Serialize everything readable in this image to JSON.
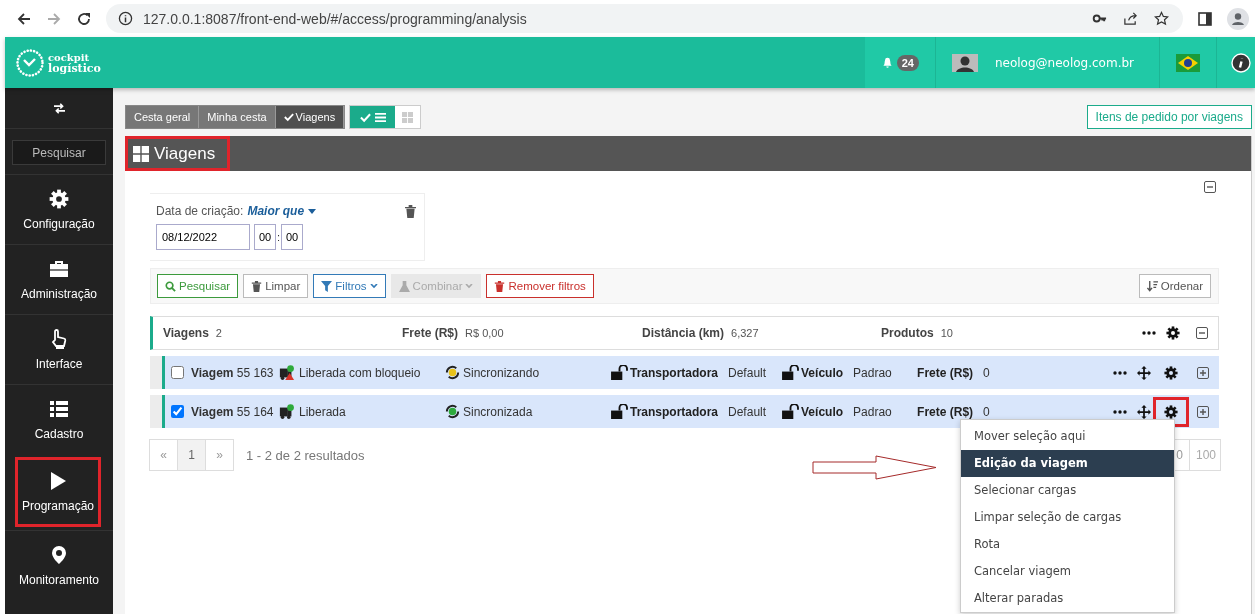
{
  "browser": {
    "url": "127.0.0.1:8087/front-end-web/#/access/programming/analysis",
    "forward_disabled": true
  },
  "header": {
    "logo": [
      "cockpit",
      "logístico"
    ],
    "notifications": "24",
    "user": "neolog@neolog.com.br"
  },
  "sidebar": {
    "search": {
      "placeholder": "Pesquisar"
    },
    "items": [
      {
        "label": "Configuração",
        "kind": "gear",
        "highlighted": false
      },
      {
        "label": "Administração",
        "kind": "briefcase",
        "highlighted": false
      },
      {
        "label": "Interface",
        "kind": "hand",
        "highlighted": false
      },
      {
        "label": "Cadastro",
        "kind": "list",
        "highlighted": false
      },
      {
        "label": "Programação",
        "kind": "play",
        "highlighted": true
      },
      {
        "label": "Monitoramento",
        "kind": "pin",
        "highlighted": false
      }
    ]
  },
  "tabs": [
    {
      "label": "Cesta geral",
      "selected": false
    },
    {
      "label": "Minha cesta",
      "selected": false
    },
    {
      "label": "Viagens",
      "selected": true
    }
  ],
  "views": [
    {
      "kind": "list",
      "selected": true
    },
    {
      "kind": "grid",
      "selected": false
    }
  ],
  "side_button": "Itens de pedido por viagens",
  "panel": {
    "title": "Viagens",
    "highlighted": true
  },
  "filter": {
    "label": "Data de criação:",
    "operator": "Maior que",
    "date": "08/12/2022",
    "hour": "00",
    "separator": ":",
    "minute": "00"
  },
  "toolbar": [
    {
      "label": "Pesquisar",
      "kind": "search",
      "caret": false,
      "disabled": false
    },
    {
      "label": "Limpar",
      "kind": "clear",
      "caret": false,
      "disabled": false
    },
    {
      "label": "Filtros",
      "kind": "filter",
      "caret": true,
      "disabled": false
    },
    {
      "label": "Combinar",
      "kind": "combine",
      "caret": true,
      "disabled": true
    },
    {
      "label": "Remover filtros",
      "kind": "remove",
      "caret": false,
      "disabled": false
    }
  ],
  "sort_button": "Ordenar",
  "summary": [
    {
      "label": "Viagens",
      "value": "2"
    },
    {
      "label": "Frete (R$)",
      "value": "R$ 0,00"
    },
    {
      "label": "Distância (km)",
      "value": "6,327"
    },
    {
      "label": "Produtos",
      "value": "10"
    }
  ],
  "trips": [
    {
      "checked": false,
      "label": "Viagem",
      "number": "55 163",
      "status": {
        "text": "Liberada com bloqueio",
        "kind": "blocked"
      },
      "sync": {
        "text": "Sincronizando",
        "kind": "pending"
      },
      "carrier_label": "Transportadora",
      "carrier": "Default",
      "vehicle_label": "Veículo",
      "vehicle": "Padrao",
      "freight_label": "Frete (R$)",
      "freight": "0",
      "gear_highlighted": false
    },
    {
      "checked": true,
      "label": "Viagem",
      "number": "55 164",
      "status": {
        "text": "Liberada",
        "kind": "released"
      },
      "sync": {
        "text": "Sincronizada",
        "kind": "done"
      },
      "carrier_label": "Transportadora",
      "carrier": "Default",
      "vehicle_label": "Veículo",
      "vehicle": "Padrao",
      "freight_label": "Frete (R$)",
      "freight": "0",
      "gear_highlighted": true
    }
  ],
  "pagination": {
    "prev": "«",
    "pages": [
      {
        "label": "1",
        "selected": true
      }
    ],
    "next": "»",
    "summary": "1 - 2 de 2 resultados",
    "page_sizes": [
      "0",
      "100"
    ]
  },
  "context_menu": [
    {
      "label": "Mover seleção aqui",
      "selected": false
    },
    {
      "label": "Edição da viagem",
      "selected": true
    },
    {
      "label": "Selecionar cargas",
      "selected": false
    },
    {
      "label": "Limpar seleção de cargas",
      "selected": false
    },
    {
      "label": "Rota",
      "selected": false
    },
    {
      "label": "Cancelar viagem",
      "selected": false
    },
    {
      "label": "Alterar paradas",
      "selected": false
    }
  ]
}
